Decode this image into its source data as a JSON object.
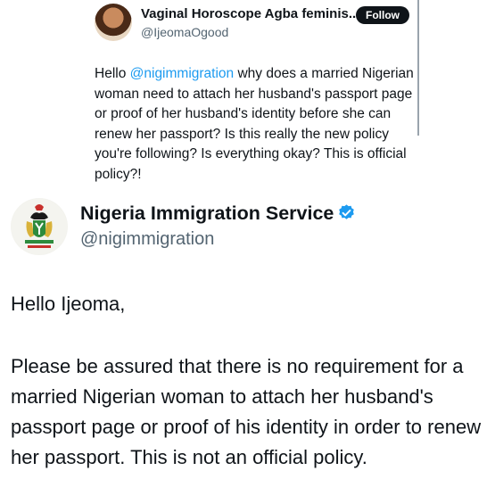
{
  "quoted_tweet": {
    "author_name": "Vaginal Horoscope Agba feminis...",
    "author_handle": "@IjeomaOgood",
    "follow_label": "Follow",
    "text_before_mention": "Hello ",
    "mention": "@nigimmigration",
    "text_after_mention": " why does a married Nigerian woman need to attach her husband's passport page or proof of her husband's identity before she can renew her passport? Is this really the new policy you're following? Is everything okay? This is official policy?!"
  },
  "reply_tweet": {
    "author_name": "Nigeria Immigration Service",
    "author_handle": "@nigimmigration",
    "greeting": "Hello Ijeoma,",
    "body": "Please be assured that there is no requirement for a married Nigerian woman to attach her husband's passport page or proof of his identity in order to renew her passport. This is not an official policy."
  },
  "colors": {
    "link": "#1d9bf0",
    "verified_badge": "#1d9bf0",
    "secondary_text": "#536471"
  }
}
